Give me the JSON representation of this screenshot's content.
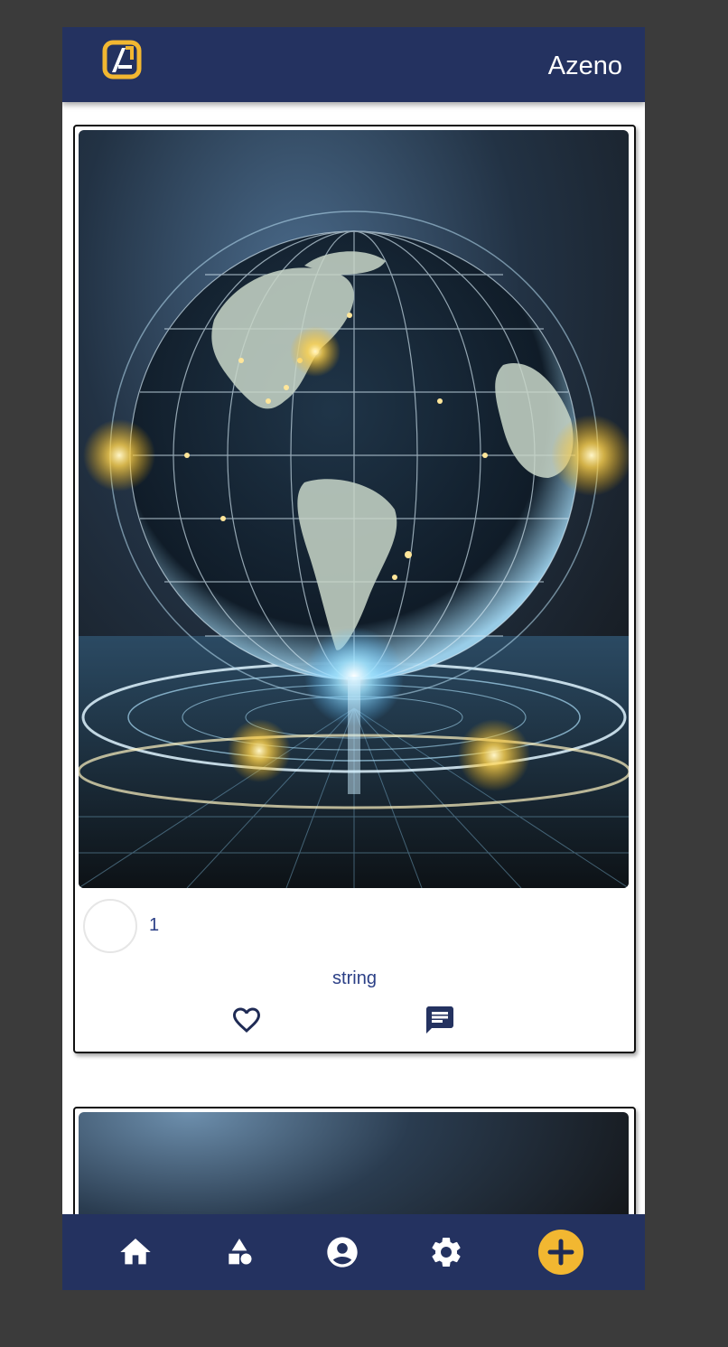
{
  "app": {
    "name": "Azeno"
  },
  "colors": {
    "brand_navy": "#243260",
    "accent_yellow": "#f2b731",
    "text_blue": "#2b3f86"
  },
  "posts": [
    {
      "author": "1",
      "caption": "string",
      "image": "globe-network-image",
      "liked": false
    },
    {
      "author": "",
      "caption": "",
      "image": "globe-network-image"
    }
  ],
  "icons": {
    "logo": "azeno-logo-icon",
    "like": "heart-outline-icon",
    "comment": "chat-bubble-icon",
    "nav": [
      "home-icon",
      "shapes-icon",
      "account-circle-icon",
      "gear-icon",
      "plus-icon"
    ]
  }
}
